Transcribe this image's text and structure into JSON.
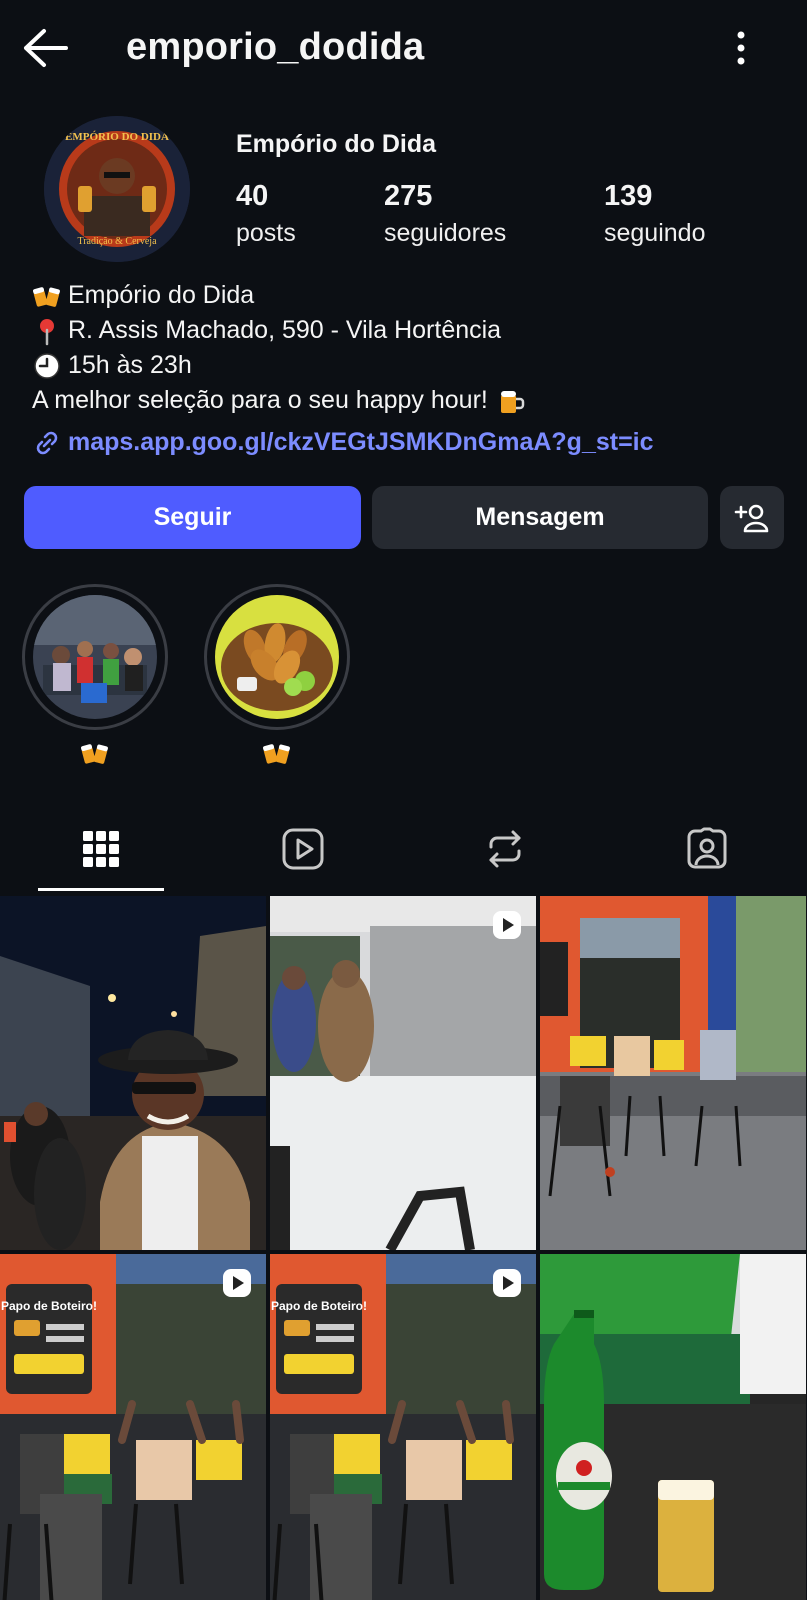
{
  "header": {
    "username": "emporio_dodida"
  },
  "profile": {
    "display_name": "Empório do Dida",
    "stats": {
      "posts_count": "40",
      "posts_label": "posts",
      "followers_count": "275",
      "followers_label": "seguidores",
      "following_count": "139",
      "following_label": "seguindo"
    },
    "avatar_text_top": "EMPÓRIO DO DIDA",
    "avatar_text_bottom": "Tradição & Cerveja",
    "bio": {
      "line1": "Empório do Dida",
      "line2": "R. Assis Machado, 590 - Vila Hortência",
      "line3": "15h às 23h",
      "line4": "A melhor seleção para o seu happy hour!",
      "link": "maps.app.goo.gl/ckzVEGtJSMKDnGmaA?g_st=ic"
    }
  },
  "actions": {
    "follow_label": "Seguir",
    "message_label": "Mensagem"
  },
  "highlights": [
    {
      "icon": "clinking-beer-mugs-emoji"
    },
    {
      "icon": "clinking-beer-mugs-emoji"
    }
  ],
  "tabs": [
    {
      "icon": "grid-icon",
      "selected": true
    },
    {
      "icon": "reels-icon",
      "selected": false
    },
    {
      "icon": "reposts-icon",
      "selected": false
    },
    {
      "icon": "tagged-icon",
      "selected": false
    }
  ],
  "posts": [
    {
      "kind": "photo"
    },
    {
      "kind": "reel"
    },
    {
      "kind": "photo"
    },
    {
      "kind": "reel",
      "sign_text": "Papo de Boteiro!"
    },
    {
      "kind": "reel",
      "sign_text": "Papo de Boteiro!"
    },
    {
      "kind": "photo"
    }
  ],
  "colors": {
    "background": "#0c0f14",
    "follow_button": "#4f5cff",
    "secondary_button": "#262a31",
    "link": "#7c8cff"
  }
}
